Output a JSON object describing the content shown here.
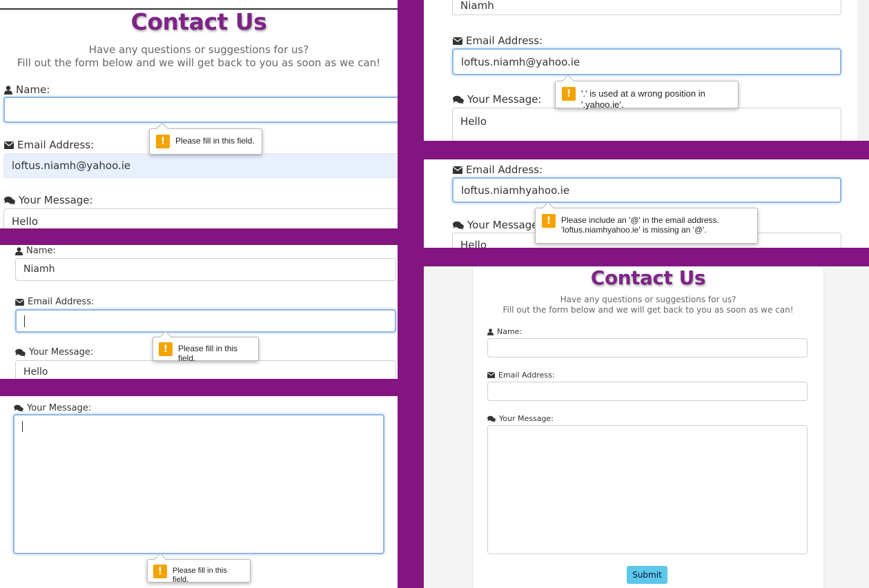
{
  "form": {
    "heading": "Contact Us",
    "subtitle_line1": "Have any questions or suggestions for us?",
    "subtitle_line2": "Fill out the form below and we will get back to you as soon as we can!",
    "name_label": "Name:",
    "email_label": "Email Address:",
    "message_label": "Your Message:",
    "submit_label": "Submit"
  },
  "panel1": {
    "name_value": "",
    "email_value": "loftus.niamh@yahoo.ie",
    "message_value": "Hello",
    "tooltip": "Please fill in this field."
  },
  "panel2": {
    "name_value": "Niamh",
    "email_value": "",
    "message_value": "Hello",
    "tooltip": "Please fill in this field."
  },
  "panel3": {
    "message_value": "",
    "tooltip": "Please fill in this field."
  },
  "panel4": {
    "name_value": "Niamh",
    "email_value": "loftus.niamh@yahoo.ie",
    "message_value": "Hello",
    "tooltip": "'.' is used at a wrong position in '.yahoo.ie'."
  },
  "panel5": {
    "email_value": "loftus.niamhyahoo.ie",
    "message_value": "Hello",
    "tooltip_line1": "Please include an '@' in the email address.",
    "tooltip_line2": "'loftus.niamhyahoo.ie' is missing an '@'."
  },
  "panel6": {
    "name_value": "",
    "email_value": "",
    "message_value": ""
  },
  "colors": {
    "accent": "#82157f",
    "heading": "#7d2486",
    "warning": "#f5a300",
    "submit": "#5bc8e8",
    "focus": "#8fb6e6"
  },
  "icons": [
    "user-icon",
    "envelope-icon",
    "comments-icon",
    "warning-icon"
  ]
}
